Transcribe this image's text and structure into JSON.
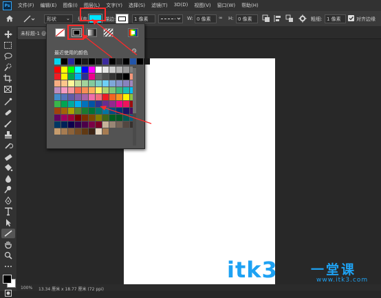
{
  "menubar": {
    "logo": "Ps",
    "items": [
      "文件(F)",
      "编辑(E)",
      "图像(I)",
      "图层(L)",
      "文字(Y)",
      "选择(S)",
      "滤镜(T)",
      "3D(D)",
      "视图(V)",
      "窗口(W)",
      "帮助(H)"
    ]
  },
  "options": {
    "mode_value": "形状",
    "fill_label": "填充:",
    "fill_color": "#00e5ff",
    "stroke_label": "描边:",
    "stroke_width": "1 像素",
    "w_label": "W:",
    "w_value": "0 像素",
    "link_symbol": "∞",
    "h_label": "H:",
    "h_value": "0 像素",
    "thickness_label": "粗细:",
    "thickness_value": "1 像素",
    "align_edges_label": "对齐边缘",
    "align_edges_checked": true
  },
  "document": {
    "tab_title": "未标题-1 @",
    "zoom": "100%",
    "doc_info": "13.34 厘米 x 18.77 厘米 (72 ppi)"
  },
  "picker": {
    "recent_label": "最近使用的颜色",
    "recent_colors": [
      "#00d5f0",
      "#000000",
      "#2a2a9a",
      "#000000",
      "#1a1a1a",
      "#000000",
      "#1a1a1a",
      "#3b2a9e",
      "#000000",
      "#2a2a2a",
      "#000000",
      "#2255aa",
      "#000000",
      "#1a1a1a"
    ],
    "swatches": [
      "#ff0000",
      "#ffff00",
      "#00ff00",
      "#00ffff",
      "#0000ff",
      "#ff00ff",
      "#ffffff",
      "#e5e5e5",
      "#cccccc",
      "#b2b2b2",
      "#999999",
      "#808080",
      "#ee1c24",
      "#fff200",
      "#00a651",
      "#00aeef",
      "#2e3192",
      "#ec008c",
      "#666666",
      "#4d4d4d",
      "#333333",
      "#1a1a1a",
      "#000000",
      "#f7977a",
      "#f9ad81",
      "#fdc68a",
      "#fff799",
      "#c4df9b",
      "#a3d39c",
      "#82ca9d",
      "#7bcdc8",
      "#6ecff6",
      "#7ea7d8",
      "#8493ca",
      "#8882be",
      "#a187be",
      "#bc8dbf",
      "#f49ac2",
      "#f6989d",
      "#f26c4f",
      "#f68e55",
      "#fbaf5c",
      "#fff467",
      "#acd372",
      "#7cc576",
      "#3bb878",
      "#1abbb4",
      "#00bff3",
      "#438ccb",
      "#5574b9",
      "#605ca8",
      "#8560a8",
      "#a864a8",
      "#f06eaa",
      "#f26d7d",
      "#ed1c24",
      "#f26522",
      "#f7941d",
      "#fff200",
      "#8dc63f",
      "#39b54a",
      "#00a651",
      "#00a99d",
      "#00aeef",
      "#0072bc",
      "#0054a6",
      "#2e3192",
      "#662d91",
      "#92278f",
      "#ec008c",
      "#ed145b",
      "#9e0b0f",
      "#a0410d",
      "#a36209",
      "#aba000",
      "#598527",
      "#1a7b30",
      "#007236",
      "#00746b",
      "#0076a3",
      "#004b80",
      "#003471",
      "#1b1464",
      "#440e62",
      "#630460",
      "#9e005d",
      "#9e0039",
      "#790000",
      "#7b2e00",
      "#7d4900",
      "#827b00",
      "#406618",
      "#005e20",
      "#005826",
      "#005952",
      "#005b7f",
      "#003663",
      "#002157",
      "#0d004c",
      "#32004b",
      "#4b0049",
      "#7b0046",
      "#7a0026",
      "#c7b299",
      "#998675",
      "#736357",
      "#534741",
      "#37302d",
      "#c69c6d",
      "#a67c52",
      "#8c6239",
      "#754c24",
      "#603913",
      "#3c2415",
      "#e6d6bf",
      "#a67c52"
    ]
  },
  "watermark": {
    "text": "itk3",
    "cn_text": "一堂课",
    "url": "www.itk3.com"
  }
}
